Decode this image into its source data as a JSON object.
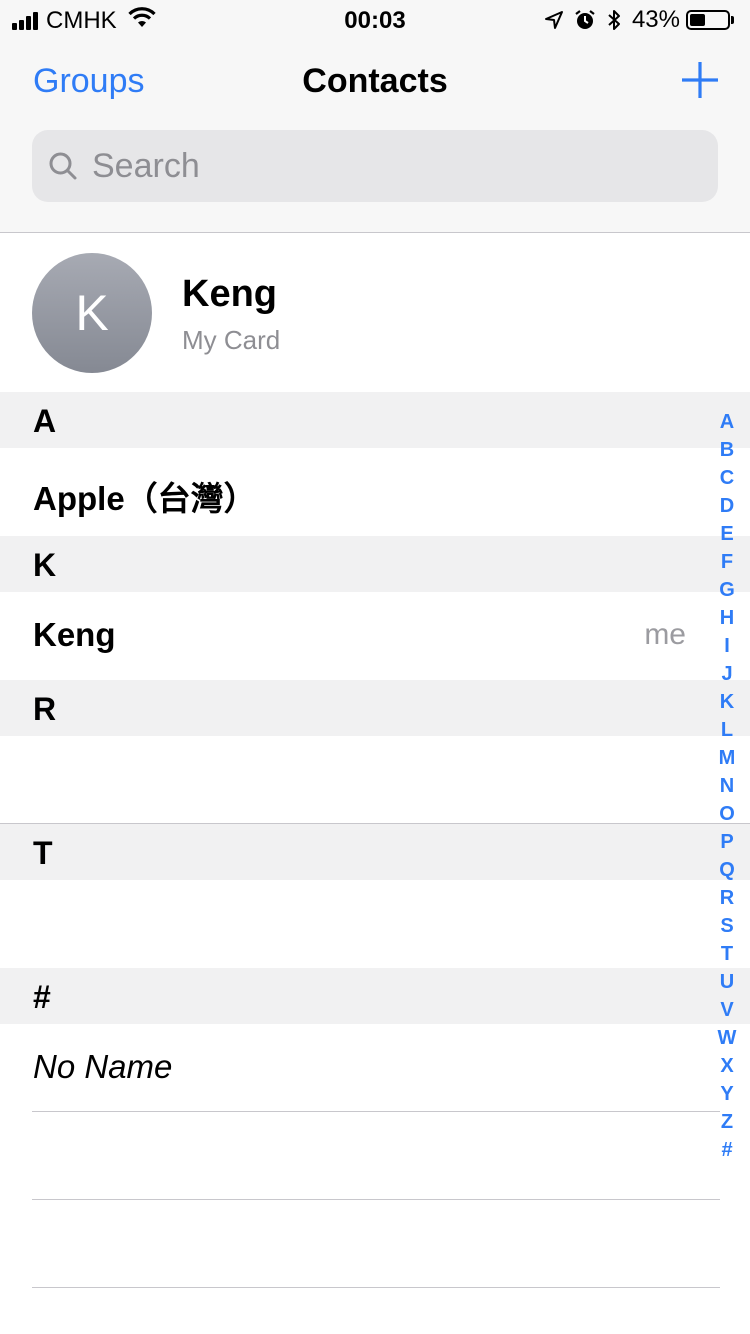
{
  "status_bar": {
    "carrier": "CMHK",
    "time": "00:03",
    "battery_percent": "43%",
    "battery_level": 0.43,
    "icons": [
      "signal-icon",
      "wifi-icon",
      "location-arrow-icon",
      "alarm-icon",
      "bluetooth-icon",
      "battery-icon"
    ]
  },
  "nav": {
    "left_label": "Groups",
    "title": "Contacts",
    "add_icon": "plus-icon"
  },
  "search": {
    "placeholder": "Search",
    "icon": "search-icon"
  },
  "my_card": {
    "initial": "K",
    "name": "Keng",
    "subtitle": "My Card"
  },
  "sections": [
    {
      "letter": "A",
      "rows": [
        {
          "name": "Apple（台灣）",
          "style": "bold"
        }
      ]
    },
    {
      "letter": "K",
      "rows": [
        {
          "name": "Keng",
          "style": "bold",
          "note": "me"
        }
      ]
    },
    {
      "letter": "R",
      "rows": [
        {
          "name": ""
        }
      ]
    },
    {
      "letter": "T",
      "rows": [
        {
          "name": ""
        }
      ]
    },
    {
      "letter": "#",
      "rows": [
        {
          "name": "No Name",
          "style": "italic"
        },
        {
          "name": ""
        },
        {
          "name": ""
        }
      ]
    }
  ],
  "index_letters": [
    "A",
    "B",
    "C",
    "D",
    "E",
    "F",
    "G",
    "H",
    "I",
    "J",
    "K",
    "L",
    "M",
    "N",
    "O",
    "P",
    "Q",
    "R",
    "S",
    "T",
    "U",
    "V",
    "W",
    "X",
    "Y",
    "Z",
    "#"
  ],
  "colors": {
    "accent": "#2f7cf6",
    "header_bg": "#f7f7f7",
    "section_bg": "#f1f1f2",
    "secondary_text": "#8e8e93"
  }
}
